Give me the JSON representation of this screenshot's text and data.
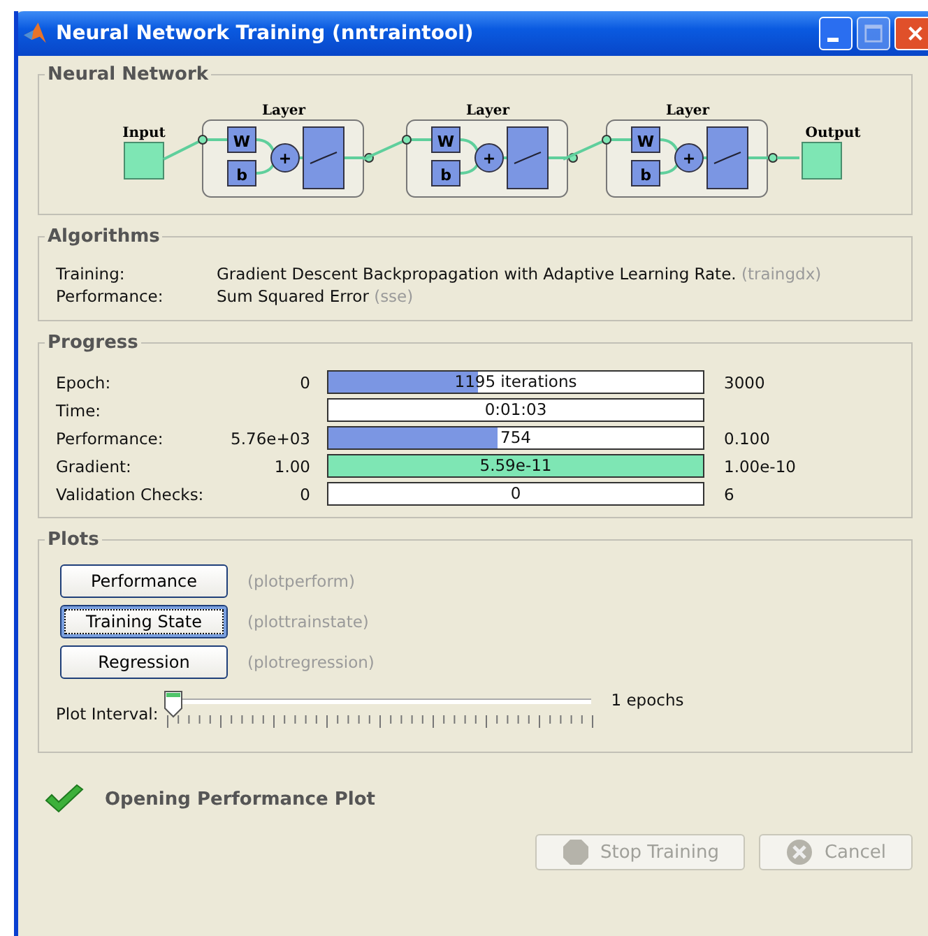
{
  "window": {
    "title": "Neural Network Training (nntraintool)"
  },
  "network": {
    "title": "Neural Network",
    "input_label": "Input",
    "output_label": "Output",
    "layers": [
      {
        "label": "Layer",
        "weight": "W",
        "bias": "b",
        "sum": "+"
      },
      {
        "label": "Layer",
        "weight": "W",
        "bias": "b",
        "sum": "+"
      },
      {
        "label": "Layer",
        "weight": "W",
        "bias": "b",
        "sum": "+"
      }
    ]
  },
  "algorithms": {
    "title": "Algorithms",
    "rows": [
      {
        "label": "Training:",
        "value": "Gradient Descent Backpropagation with Adaptive Learning Rate.",
        "code": "(traingdx)"
      },
      {
        "label": "Performance:",
        "value": "Sum Squared Error",
        "code": "(sse)"
      }
    ]
  },
  "progress": {
    "title": "Progress",
    "rows": [
      {
        "label": "Epoch:",
        "start": "0",
        "bar": "1195 iterations",
        "level": 0.4,
        "color": "#7b96e3",
        "end": "3000"
      },
      {
        "label": "Time:",
        "bar": "0:01:03",
        "level": 0
      },
      {
        "label": "Performance:",
        "start": "5.76e+03",
        "bar": "754",
        "level": 0.45,
        "color": "#7b96e3",
        "end": "0.100"
      },
      {
        "label": "Gradient:",
        "start": "1.00",
        "bar": "5.59e-11",
        "level": 1,
        "color": "#7ee6b4",
        "end": "1.00e-10"
      },
      {
        "label": "Validation Checks:",
        "start": "0",
        "bar": "0",
        "level": 0,
        "end": "6"
      }
    ]
  },
  "plots": {
    "title": "Plots",
    "buttons": [
      {
        "label": "Performance",
        "code": "(plotperform)",
        "focused": false
      },
      {
        "label": "Training State",
        "code": "(plottrainstate)",
        "focused": true
      },
      {
        "label": "Regression",
        "code": "(plotregression)",
        "focused": false
      }
    ],
    "interval": {
      "label": "Plot Interval:",
      "level": 0,
      "reading": "1 epochs"
    }
  },
  "status": {
    "text": "Opening Performance Plot"
  },
  "buttons": [
    {
      "kind": "stop",
      "label": "Stop Training",
      "disabled": true
    },
    {
      "kind": "cancel",
      "label": "Cancel",
      "disabled": true
    }
  ]
}
